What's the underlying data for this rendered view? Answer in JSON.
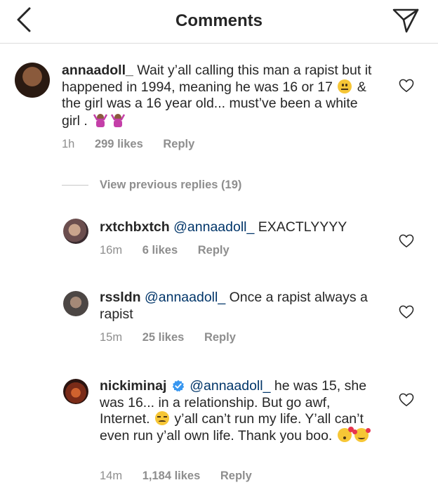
{
  "header": {
    "title": "Comments",
    "back_icon": "chevron-left-icon",
    "send_icon": "paper-plane-icon"
  },
  "colors": {
    "text": "#262626",
    "meta": "#8e8e8e",
    "mention": "#003569",
    "verified": "#3897f0",
    "divider": "#dbdbdb"
  },
  "comments": [
    {
      "username": "annaadoll_",
      "text_1": "Wait y’all calling this man a rapist but it happened in 1994, meaning he was 16 or 17",
      "text_2": "& the girl was a 16 year old... must’ve been a white girl .",
      "emojis": [
        "neutral-face",
        "person-shrugging",
        "person-shrugging"
      ],
      "time": "1h",
      "likes": "299 likes",
      "reply": "Reply"
    }
  ],
  "view_previous": "View previous replies (19)",
  "replies": [
    {
      "username": "rxtchbxtch",
      "mention": "@annaadoll_",
      "text": "EXACTLYYYY",
      "time": "16m",
      "likes": "6 likes",
      "reply": "Reply"
    },
    {
      "username": "rssldn",
      "mention": "@annaadoll_",
      "text": "Once a rapist always a rapist",
      "time": "15m",
      "likes": "25 likes",
      "reply": "Reply"
    },
    {
      "username": "nickiminaj",
      "verified": true,
      "mention": "@annaadoll_",
      "text_1": "he was 15, she was 16... in a relationship. But go awf, Internet.",
      "text_2": "y’all can’t run my life. Y’all can’t even run y’all own life. Thank you boo.",
      "emojis": [
        "unamused-face",
        "face-blowing-kiss",
        "smiling-face-with-hearts"
      ],
      "time": "14m",
      "likes": "1,184 likes",
      "reply": "Reply"
    }
  ]
}
